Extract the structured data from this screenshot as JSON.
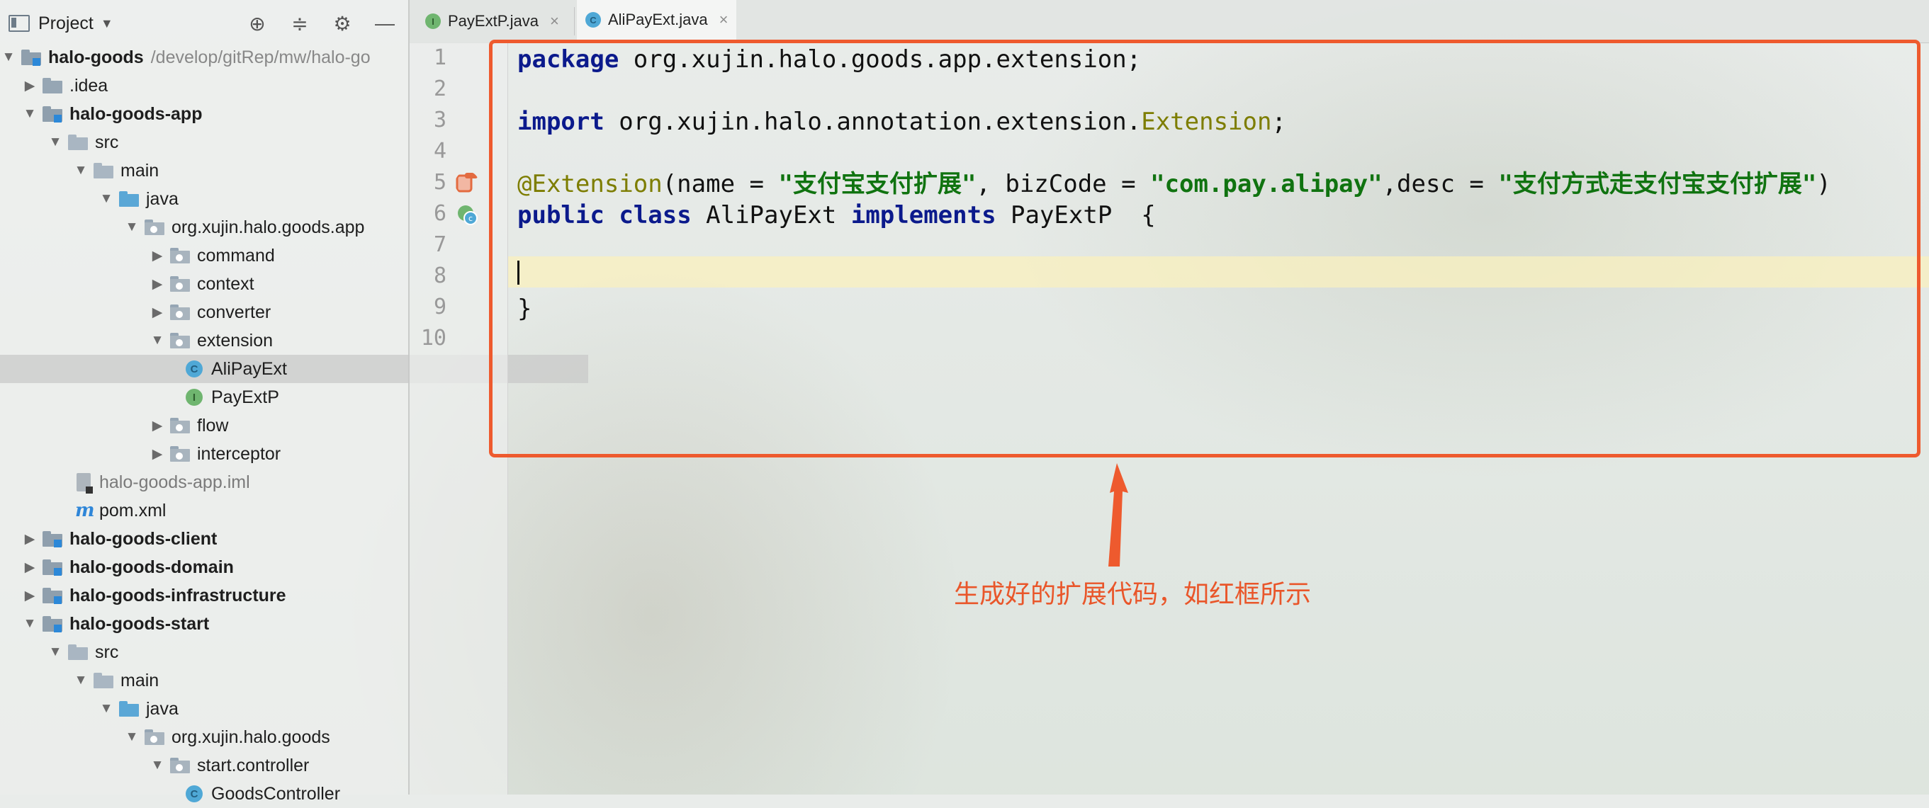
{
  "project_panel": {
    "title": "Project",
    "tree": [
      {
        "label": "halo-goods",
        "path": "/develop/gitRep/mw/halo-go",
        "bold": true
      },
      {
        "label": ".idea"
      },
      {
        "label": "halo-goods-app",
        "bold": true
      },
      {
        "label": "src"
      },
      {
        "label": "main"
      },
      {
        "label": "java"
      },
      {
        "label": "org.xujin.halo.goods.app"
      },
      {
        "label": "command"
      },
      {
        "label": "context"
      },
      {
        "label": "converter"
      },
      {
        "label": "extension"
      },
      {
        "label": "AliPayExt",
        "selected": true
      },
      {
        "label": "PayExtP"
      },
      {
        "label": "flow"
      },
      {
        "label": "interceptor"
      },
      {
        "label": "halo-goods-app.iml"
      },
      {
        "label": "pom.xml"
      },
      {
        "label": "halo-goods-client",
        "bold": true
      },
      {
        "label": "halo-goods-domain",
        "bold": true
      },
      {
        "label": "halo-goods-infrastructure",
        "bold": true
      },
      {
        "label": "halo-goods-start",
        "bold": true
      },
      {
        "label": "src"
      },
      {
        "label": "main"
      },
      {
        "label": "java"
      },
      {
        "label": "org.xujin.halo.goods"
      },
      {
        "label": "start.controller"
      },
      {
        "label": "GoodsController"
      }
    ]
  },
  "tabs": [
    {
      "label": "PayExtP.java",
      "icon": "interface-icon",
      "active": false
    },
    {
      "label": "AliPayExt.java",
      "icon": "class-icon",
      "active": true
    }
  ],
  "editor": {
    "line_numbers": [
      "1",
      "2",
      "3",
      "4",
      "5",
      "6",
      "7",
      "8",
      "9",
      "10"
    ],
    "code": {
      "l1_kw": "package",
      "l1_rest": " org.xujin.halo.goods.app.extension;",
      "l3_kw": "import",
      "l3_rest": " org.xujin.halo.annotation.extension.",
      "l3_ann": "Extension",
      "l3_end": ";",
      "l5_ann": "@Extension",
      "l5_a": "(name = ",
      "l5_s1": "\"支付宝支付扩展\"",
      "l5_b": ", bizCode = ",
      "l5_s2": "\"com.pay.alipay\"",
      "l5_c": ",desc = ",
      "l5_s3": "\"支付方式走支付宝支付扩展\"",
      "l5_d": ")",
      "l6_kw1": "public",
      "l6_kw2": "class",
      "l6_name": " AliPayExt ",
      "l6_kw3": "implements",
      "l6_rest": " PayExtP  {",
      "l9": "}"
    }
  },
  "annotation": {
    "callout_text": "生成好的扩展代码，如红框所示",
    "color": "#ee5a2e"
  }
}
